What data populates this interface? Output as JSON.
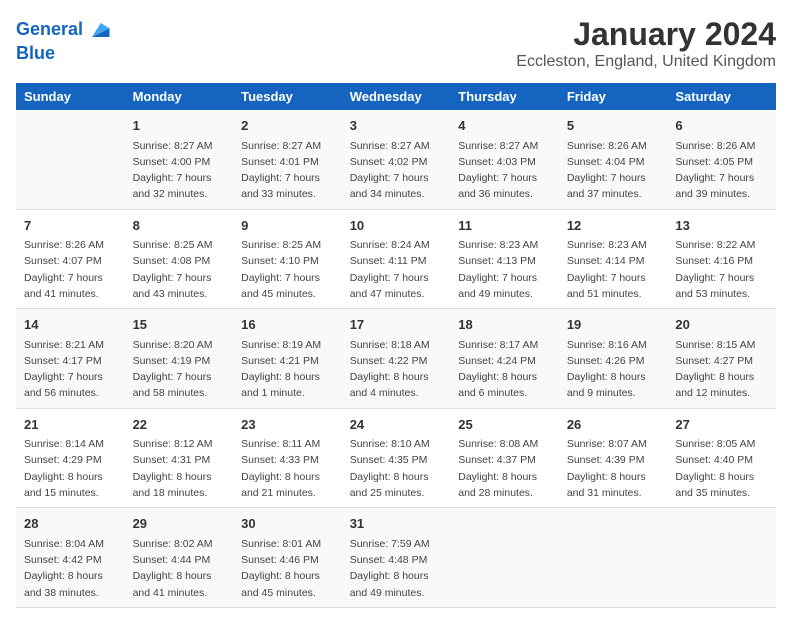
{
  "logo": {
    "line1": "General",
    "line2": "Blue"
  },
  "title": "January 2024",
  "subtitle": "Eccleston, England, United Kingdom",
  "colors": {
    "header_bg": "#1565c0",
    "header_text": "#ffffff",
    "odd_row": "#f9f9f9",
    "even_row": "#ffffff"
  },
  "days_of_week": [
    "Sunday",
    "Monday",
    "Tuesday",
    "Wednesday",
    "Thursday",
    "Friday",
    "Saturday"
  ],
  "weeks": [
    {
      "cells": [
        {
          "day": "",
          "info": ""
        },
        {
          "day": "1",
          "info": "Sunrise: 8:27 AM\nSunset: 4:00 PM\nDaylight: 7 hours\nand 32 minutes."
        },
        {
          "day": "2",
          "info": "Sunrise: 8:27 AM\nSunset: 4:01 PM\nDaylight: 7 hours\nand 33 minutes."
        },
        {
          "day": "3",
          "info": "Sunrise: 8:27 AM\nSunset: 4:02 PM\nDaylight: 7 hours\nand 34 minutes."
        },
        {
          "day": "4",
          "info": "Sunrise: 8:27 AM\nSunset: 4:03 PM\nDaylight: 7 hours\nand 36 minutes."
        },
        {
          "day": "5",
          "info": "Sunrise: 8:26 AM\nSunset: 4:04 PM\nDaylight: 7 hours\nand 37 minutes."
        },
        {
          "day": "6",
          "info": "Sunrise: 8:26 AM\nSunset: 4:05 PM\nDaylight: 7 hours\nand 39 minutes."
        }
      ]
    },
    {
      "cells": [
        {
          "day": "7",
          "info": "Sunrise: 8:26 AM\nSunset: 4:07 PM\nDaylight: 7 hours\nand 41 minutes."
        },
        {
          "day": "8",
          "info": "Sunrise: 8:25 AM\nSunset: 4:08 PM\nDaylight: 7 hours\nand 43 minutes."
        },
        {
          "day": "9",
          "info": "Sunrise: 8:25 AM\nSunset: 4:10 PM\nDaylight: 7 hours\nand 45 minutes."
        },
        {
          "day": "10",
          "info": "Sunrise: 8:24 AM\nSunset: 4:11 PM\nDaylight: 7 hours\nand 47 minutes."
        },
        {
          "day": "11",
          "info": "Sunrise: 8:23 AM\nSunset: 4:13 PM\nDaylight: 7 hours\nand 49 minutes."
        },
        {
          "day": "12",
          "info": "Sunrise: 8:23 AM\nSunset: 4:14 PM\nDaylight: 7 hours\nand 51 minutes."
        },
        {
          "day": "13",
          "info": "Sunrise: 8:22 AM\nSunset: 4:16 PM\nDaylight: 7 hours\nand 53 minutes."
        }
      ]
    },
    {
      "cells": [
        {
          "day": "14",
          "info": "Sunrise: 8:21 AM\nSunset: 4:17 PM\nDaylight: 7 hours\nand 56 minutes."
        },
        {
          "day": "15",
          "info": "Sunrise: 8:20 AM\nSunset: 4:19 PM\nDaylight: 7 hours\nand 58 minutes."
        },
        {
          "day": "16",
          "info": "Sunrise: 8:19 AM\nSunset: 4:21 PM\nDaylight: 8 hours\nand 1 minute."
        },
        {
          "day": "17",
          "info": "Sunrise: 8:18 AM\nSunset: 4:22 PM\nDaylight: 8 hours\nand 4 minutes."
        },
        {
          "day": "18",
          "info": "Sunrise: 8:17 AM\nSunset: 4:24 PM\nDaylight: 8 hours\nand 6 minutes."
        },
        {
          "day": "19",
          "info": "Sunrise: 8:16 AM\nSunset: 4:26 PM\nDaylight: 8 hours\nand 9 minutes."
        },
        {
          "day": "20",
          "info": "Sunrise: 8:15 AM\nSunset: 4:27 PM\nDaylight: 8 hours\nand 12 minutes."
        }
      ]
    },
    {
      "cells": [
        {
          "day": "21",
          "info": "Sunrise: 8:14 AM\nSunset: 4:29 PM\nDaylight: 8 hours\nand 15 minutes."
        },
        {
          "day": "22",
          "info": "Sunrise: 8:12 AM\nSunset: 4:31 PM\nDaylight: 8 hours\nand 18 minutes."
        },
        {
          "day": "23",
          "info": "Sunrise: 8:11 AM\nSunset: 4:33 PM\nDaylight: 8 hours\nand 21 minutes."
        },
        {
          "day": "24",
          "info": "Sunrise: 8:10 AM\nSunset: 4:35 PM\nDaylight: 8 hours\nand 25 minutes."
        },
        {
          "day": "25",
          "info": "Sunrise: 8:08 AM\nSunset: 4:37 PM\nDaylight: 8 hours\nand 28 minutes."
        },
        {
          "day": "26",
          "info": "Sunrise: 8:07 AM\nSunset: 4:39 PM\nDaylight: 8 hours\nand 31 minutes."
        },
        {
          "day": "27",
          "info": "Sunrise: 8:05 AM\nSunset: 4:40 PM\nDaylight: 8 hours\nand 35 minutes."
        }
      ]
    },
    {
      "cells": [
        {
          "day": "28",
          "info": "Sunrise: 8:04 AM\nSunset: 4:42 PM\nDaylight: 8 hours\nand 38 minutes."
        },
        {
          "day": "29",
          "info": "Sunrise: 8:02 AM\nSunset: 4:44 PM\nDaylight: 8 hours\nand 41 minutes."
        },
        {
          "day": "30",
          "info": "Sunrise: 8:01 AM\nSunset: 4:46 PM\nDaylight: 8 hours\nand 45 minutes."
        },
        {
          "day": "31",
          "info": "Sunrise: 7:59 AM\nSunset: 4:48 PM\nDaylight: 8 hours\nand 49 minutes."
        },
        {
          "day": "",
          "info": ""
        },
        {
          "day": "",
          "info": ""
        },
        {
          "day": "",
          "info": ""
        }
      ]
    }
  ]
}
